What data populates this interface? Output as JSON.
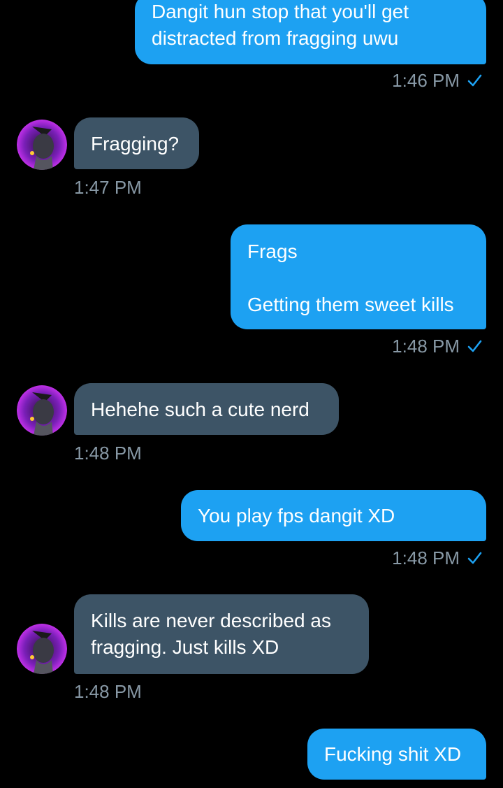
{
  "colors": {
    "background": "#000000",
    "outgoing_bubble": "#1da1f2",
    "incoming_bubble": "#3d5466",
    "timestamp": "#8899a6",
    "read_check": "#1da1f2"
  },
  "messages": [
    {
      "direction": "outgoing",
      "text": "Dangit hun stop that you'll get\ndistracted from fragging uwu",
      "time": "1:46 PM",
      "read_icon": "check-icon"
    },
    {
      "direction": "incoming",
      "text": "Fragging?",
      "time": "1:47 PM",
      "avatar_icon": "avatar-icon"
    },
    {
      "direction": "outgoing",
      "text": "Frags\n\nGetting them sweet kills",
      "time": "1:48 PM",
      "read_icon": "check-icon"
    },
    {
      "direction": "incoming",
      "text": "Hehehe such a cute nerd",
      "time": "1:48 PM",
      "avatar_icon": "avatar-icon"
    },
    {
      "direction": "outgoing",
      "text": "You play fps dangit XD",
      "time": "1:48 PM",
      "read_icon": "check-icon"
    },
    {
      "direction": "incoming",
      "text": "Kills are never described as\nfragging. Just kills XD",
      "time": "1:48 PM",
      "avatar_icon": "avatar-icon"
    },
    {
      "direction": "outgoing",
      "text": "Fucking shit XD"
    }
  ]
}
